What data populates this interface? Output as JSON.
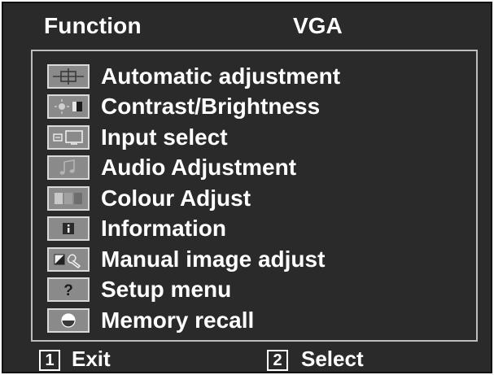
{
  "header": {
    "function_label": "Function",
    "source_label": "VGA"
  },
  "menu": {
    "items": [
      {
        "label": "Automatic adjustment",
        "icon": "crosshair-icon"
      },
      {
        "label": "Contrast/Brightness",
        "icon": "contrast-brightness-icon"
      },
      {
        "label": "Input select",
        "icon": "input-select-icon"
      },
      {
        "label": "Audio Adjustment",
        "icon": "audio-note-icon"
      },
      {
        "label": "Colour Adjust",
        "icon": "colour-bars-icon"
      },
      {
        "label": "Information",
        "icon": "info-icon"
      },
      {
        "label": "Manual image adjust",
        "icon": "manual-adjust-icon"
      },
      {
        "label": "Setup menu",
        "icon": "question-icon"
      },
      {
        "label": "Memory recall",
        "icon": "memory-recall-icon"
      }
    ]
  },
  "footer": {
    "exit_key": "1",
    "exit_label": "Exit",
    "select_key": "2",
    "select_label": "Select"
  },
  "colors": {
    "background": "#2a2a2a",
    "text": "#ffffff",
    "panel_border": "#bdbdbd",
    "icon_bg": "#8a8a8a"
  }
}
